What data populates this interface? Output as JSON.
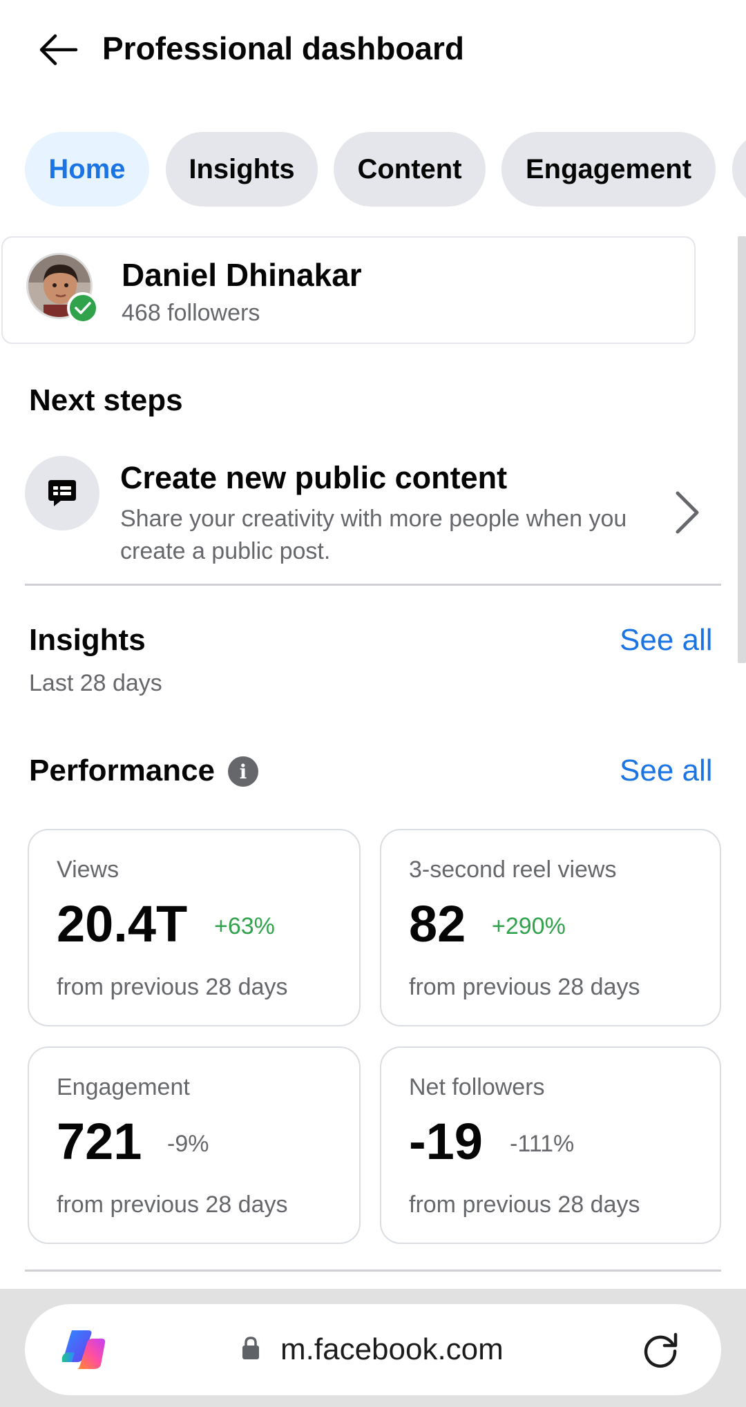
{
  "header": {
    "back_icon": "arrow-left-icon",
    "title": "Professional dashboard"
  },
  "tabs": [
    {
      "label": "Home",
      "active": true
    },
    {
      "label": "Insights",
      "active": false
    },
    {
      "label": "Content",
      "active": false
    },
    {
      "label": "Engagement",
      "active": false
    }
  ],
  "profile": {
    "name": "Daniel Dhinakar",
    "followers": "468 followers",
    "verified_icon": "check-badge-icon"
  },
  "next_steps": {
    "title": "Next steps",
    "item": {
      "icon": "post-bubble-icon",
      "title": "Create new public content",
      "description": "Share your creativity with more people when you create a public post."
    }
  },
  "insights": {
    "title": "Insights",
    "subtitle": "Last 28 days",
    "see_all": "See all"
  },
  "performance": {
    "title": "Performance",
    "see_all": "See all",
    "metrics": [
      {
        "label": "Views",
        "value": "20.4T",
        "change": "+63%",
        "trend": "up",
        "footnote": "from previous 28 days"
      },
      {
        "label": "3-second reel views",
        "value": "82",
        "change": "+290%",
        "trend": "up",
        "footnote": "from previous 28 days"
      },
      {
        "label": "Engagement",
        "value": "721",
        "change": "-9%",
        "trend": "neutral",
        "footnote": "from previous 28 days"
      },
      {
        "label": "Net followers",
        "value": "-19",
        "change": "-111%",
        "trend": "neutral",
        "footnote": "from previous 28 days"
      }
    ]
  },
  "browser": {
    "url": "m.facebook.com",
    "colors": {
      "link": "#1b74e4",
      "positive": "#31a24c",
      "secondary_text": "#65676b"
    }
  }
}
